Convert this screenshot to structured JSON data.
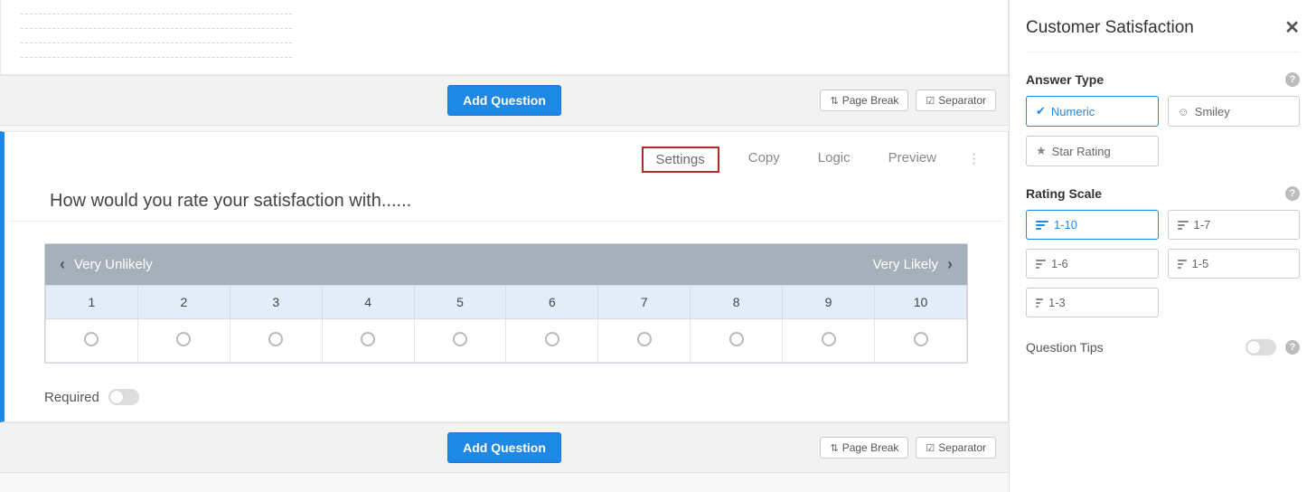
{
  "actions": {
    "add_question": "Add Question",
    "page_break": "Page Break",
    "separator": "Separator"
  },
  "question": {
    "toolbar": {
      "settings": "Settings",
      "copy": "Copy",
      "logic": "Logic",
      "preview": "Preview"
    },
    "title": "How would you rate your satisfaction with......",
    "scale": {
      "left_label": "Very Unlikely",
      "right_label": "Very Likely",
      "values": [
        "1",
        "2",
        "3",
        "4",
        "5",
        "6",
        "7",
        "8",
        "9",
        "10"
      ]
    },
    "required_label": "Required"
  },
  "sidebar": {
    "title": "Customer Satisfaction",
    "answer_type": {
      "label": "Answer Type",
      "options": {
        "numeric": "Numeric",
        "smiley": "Smiley",
        "star": "Star Rating"
      },
      "selected": "numeric"
    },
    "rating_scale": {
      "label": "Rating Scale",
      "options": {
        "r1_10": "1-10",
        "r1_7": "1-7",
        "r1_6": "1-6",
        "r1_5": "1-5",
        "r1_3": "1-3"
      },
      "selected": "r1_10"
    },
    "question_tips_label": "Question Tips"
  }
}
